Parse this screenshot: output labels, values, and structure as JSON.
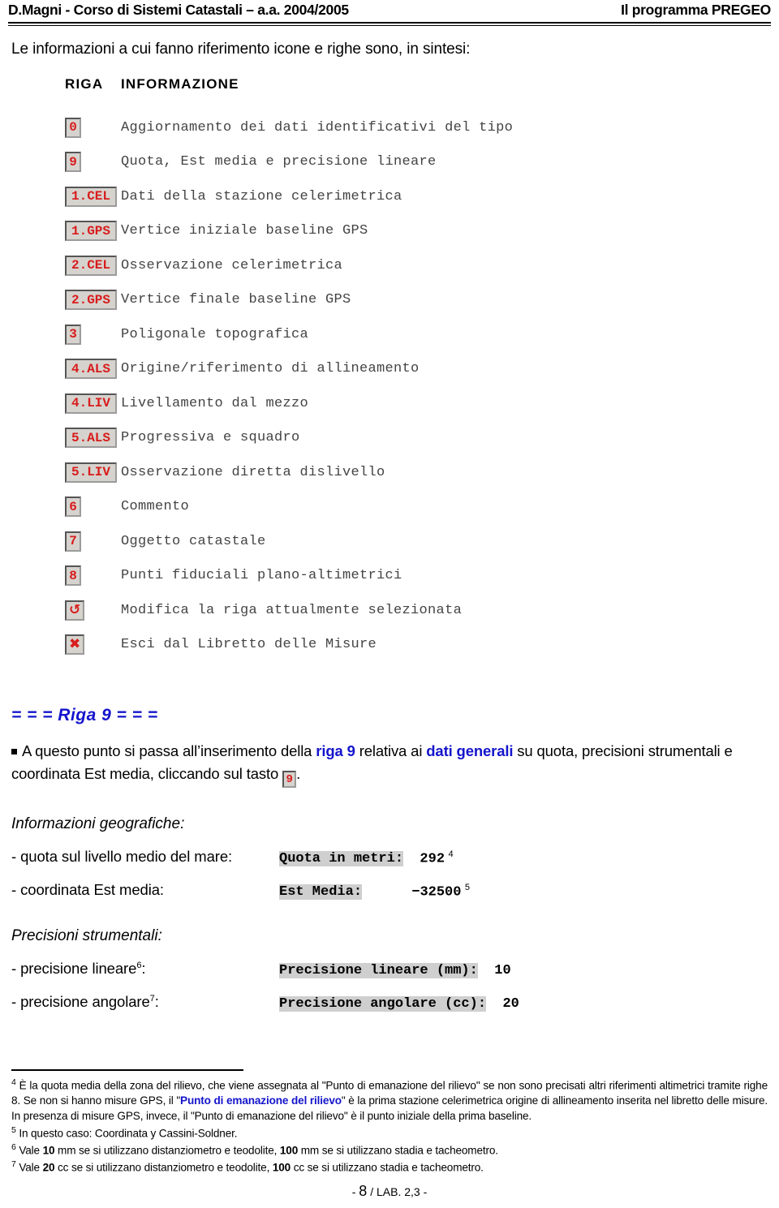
{
  "header": {
    "left": "D.Magni - Corso di Sistemi Catastali – a.a. 2004/2005",
    "right": "Il programma PREGEO"
  },
  "intro": "Le informazioni a cui fanno riferimento icone e righe sono, in sintesi:",
  "table": {
    "head_riga": "RIGA",
    "head_info": "INFORMAZIONE",
    "rows": [
      {
        "code": "0",
        "kind": "text",
        "desc": "Aggiornamento dei dati identificativi del tipo"
      },
      {
        "code": "9",
        "kind": "text",
        "desc": "Quota, Est media e precisione lineare"
      },
      {
        "code": "1.CEL",
        "kind": "text",
        "desc": "Dati della stazione celerimetrica"
      },
      {
        "code": "1.GPS",
        "kind": "text",
        "desc": "Vertice iniziale baseline GPS"
      },
      {
        "code": "2.CEL",
        "kind": "text",
        "desc": "Osservazione celerimetrica"
      },
      {
        "code": "2.GPS",
        "kind": "text",
        "desc": "Vertice finale baseline GPS"
      },
      {
        "code": "3",
        "kind": "text",
        "desc": "Poligonale topografica"
      },
      {
        "code": "4.ALS",
        "kind": "text",
        "desc": "Origine/riferimento di allineamento"
      },
      {
        "code": "4.LIV",
        "kind": "text",
        "desc": "Livellamento dal mezzo"
      },
      {
        "code": "5.ALS",
        "kind": "text",
        "desc": "Progressiva e squadro"
      },
      {
        "code": "5.LIV",
        "kind": "text",
        "desc": "Osservazione diretta dislivello"
      },
      {
        "code": "6",
        "kind": "text",
        "desc": "Commento"
      },
      {
        "code": "7",
        "kind": "text",
        "desc": "Oggetto catastale"
      },
      {
        "code": "8",
        "kind": "text",
        "desc": "Punti fiduciali plano-altimetrici"
      },
      {
        "code": "↺",
        "kind": "icon",
        "icon": "refresh-circular-arrow-icon",
        "desc": "Modifica la riga attualmente selezionata"
      },
      {
        "code": "✖",
        "kind": "icon",
        "icon": "close-x-icon",
        "desc": "Esci dal Libretto delle Misure"
      }
    ]
  },
  "riga9": {
    "heading": "= = = Riga 9 = = =",
    "para": {
      "p1": "A questo punto si passa all’inserimento della ",
      "b1": "riga 9",
      "p2": " relativa ai ",
      "b2": "dati generali",
      "p3": " su quota, precisioni strumentali e coordinata Est media, cliccando sul tasto ",
      "chip": "9",
      "p4": "."
    }
  },
  "geo": {
    "title": "Informazioni geografiche:",
    "rows": [
      {
        "label": "- quota sul livello medio del mare:",
        "field": "Quota in metri:",
        "value": "  292",
        "note": "4"
      },
      {
        "label": "- coordinata Est media:",
        "field": "Est Media:",
        "value": "      −32500",
        "note": "5"
      }
    ]
  },
  "precision": {
    "title": "Precisioni strumentali:",
    "rows": [
      {
        "label_pre": "- precisione lineare",
        "label_note": "6",
        "label_post": ":",
        "field": "Precisione lineare (mm):",
        "value": "  10"
      },
      {
        "label_pre": "- precisione angolare",
        "label_note": "7",
        "label_post": ":",
        "field": "Precisione angolare (cc):",
        "value": "  20"
      }
    ]
  },
  "footnotes": {
    "f4": {
      "mark": "4",
      "t1": " È la quota media della zona del rilievo, che viene assegnata al \"Punto di emanazione del rilievo\" se non sono precisati altri riferimenti altimetrici tramite righe 8. Se non si hanno misure GPS, il \"",
      "blue": "Punto di emanazione del rilievo",
      "t2": "\" è la prima stazione celerimetrica origine di allineamento inserita nel libretto delle misure. In presenza di misure GPS, invece, il \"Punto di emanazione del rilievo\" è il punto iniziale della prima baseline."
    },
    "f5": {
      "mark": "5",
      "text": " In questo caso: Coordinata y Cassini-Soldner."
    },
    "f6": {
      "mark": "6",
      "t1": " Vale ",
      "b1": "10",
      "t2": " mm se si utilizzano distanziometro e teodolite, ",
      "b2": "100",
      "t3": " mm se si utilizzano stadia e tacheometro."
    },
    "f7": {
      "mark": "7",
      "t1": " Vale ",
      "b1": "20",
      "t2": " cc se si utilizzano distanziometro e teodolite, ",
      "b2": "100",
      "t3": " cc se si utilizzano stadia e tacheometro."
    }
  },
  "footer": {
    "dash_l": "- ",
    "page": "8",
    "rest": " / LAB. 2,3 -"
  },
  "colors": {
    "chip_text": "#d81c1c",
    "chip_bg": "#d6d3ce",
    "accent_blue": "#1414cc",
    "field_bg": "#cfcfcf",
    "desc_text": "#444444"
  }
}
